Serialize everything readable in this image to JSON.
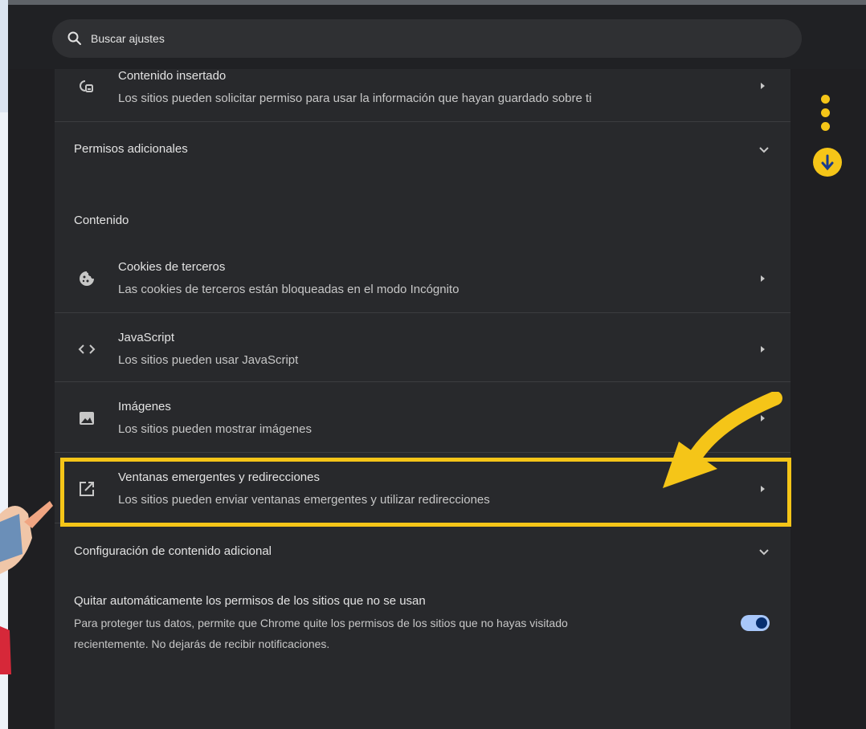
{
  "search": {
    "placeholder": "Buscar ajustes"
  },
  "rows": {
    "embedded": {
      "title": "Contenido insertado",
      "subtitle": "Los sitios pueden solicitar permiso para usar la información que hayan guardado sobre ti",
      "icon": "embedded-content-icon"
    },
    "additional_permissions": {
      "title": "Permisos adicionales"
    },
    "content_heading": {
      "title": "Contenido"
    },
    "cookies": {
      "title": "Cookies de terceros",
      "subtitle": "Las cookies de terceros están bloqueadas en el modo Incógnito",
      "icon": "cookie-icon"
    },
    "javascript": {
      "title": "JavaScript",
      "subtitle": "Los sitios pueden usar JavaScript",
      "icon": "code-icon"
    },
    "images": {
      "title": "Imágenes",
      "subtitle": "Los sitios pueden mostrar imágenes",
      "icon": "image-icon"
    },
    "popups": {
      "title": "Ventanas emergentes y redirecciones",
      "subtitle": "Los sitios pueden enviar ventanas emergentes y utilizar redirecciones",
      "icon": "open-in-new-icon"
    },
    "additional_content": {
      "title": "Configuración de contenido adicional"
    },
    "auto_remove": {
      "title": "Quitar automáticamente los permisos de los sitios que no se usan",
      "desc_line1": "Para proteger tus datos, permite que Chrome quite los permisos de los sitios que no hayas visitado",
      "desc_line2": "recientemente. No dejarás de recibir notificaciones.",
      "toggle_on": true
    }
  },
  "colors": {
    "highlight": "#f5c518",
    "toggle_track": "#a8c7fa",
    "toggle_knob": "#062e6f",
    "background": "#28292c"
  }
}
